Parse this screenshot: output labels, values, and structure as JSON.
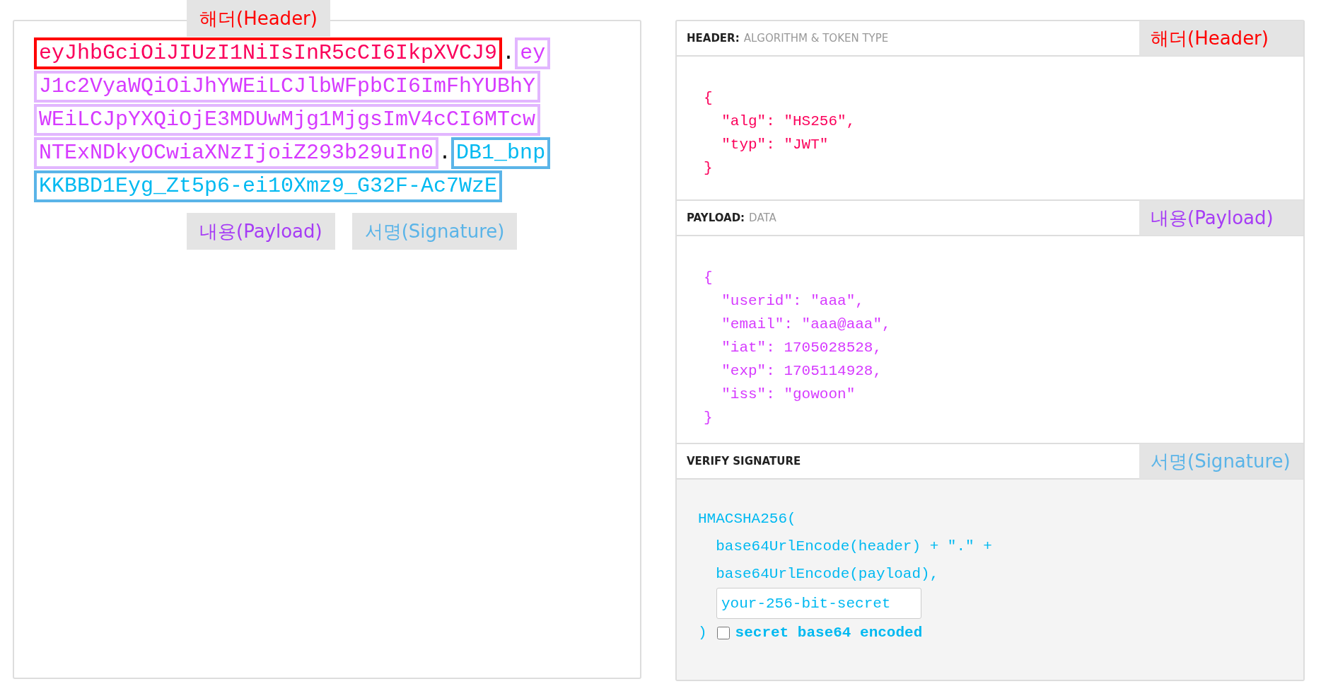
{
  "token": {
    "lines": [
      [
        {
          "kind": "header",
          "text": "eyJhbGciOiJIUzI1NiIsInR5cCI6IkpXVCJ9"
        },
        {
          "kind": "dot",
          "text": "."
        },
        {
          "kind": "payload",
          "text": "ey"
        }
      ],
      [
        {
          "kind": "payload",
          "text": "J1c2VyaWQiOiJhYWEiLCJlbWFpbCI6ImFhYUBhY"
        }
      ],
      [
        {
          "kind": "payload",
          "text": "WEiLCJpYXQiOjE3MDUwMjg1MjgsImV4cCI6MTcw"
        }
      ],
      [
        {
          "kind": "payload",
          "text": "NTExNDkyOCwiaXNzIjoiZ293b29uIn0"
        },
        {
          "kind": "dot",
          "text": "."
        },
        {
          "kind": "signature",
          "text": "DB1_bnp"
        }
      ],
      [
        {
          "kind": "signature",
          "text": "KKBBD1Eyg_Zt5p6-ei10Xmz9_G32F-Ac7WzE"
        }
      ]
    ],
    "labels": [
      {
        "text": "해더(Header)",
        "color": "#ff0000"
      },
      {
        "text": "내용(Payload)",
        "color": "#a63cf5"
      },
      {
        "text": "서명(Signature)",
        "color": "#5ab4e8"
      }
    ]
  },
  "sections": [
    {
      "kind": "header",
      "title": "HEADER:",
      "subtitle": "ALGORITHM & TOKEN TYPE",
      "label": "해더(Header)",
      "color": "#ff0000",
      "code": [
        "{",
        "  \"alg\": \"HS256\",",
        "  \"typ\": \"JWT\"",
        "}"
      ]
    },
    {
      "kind": "payload",
      "title": "PAYLOAD:",
      "subtitle": "DATA",
      "label": "내용(Payload)",
      "color": "#a63cf5",
      "code": [
        "{",
        "  \"userid\": \"aaa\",",
        "  \"email\": \"aaa@aaa\",",
        "  \"iat\": 1705028528,",
        "  \"exp\": 1705114928,",
        "  \"iss\": \"gowoon\"",
        "}"
      ]
    },
    {
      "kind": "signature",
      "title": "VERIFY SIGNATURE",
      "label": "서명(Signature)",
      "color": "#5ab4e8",
      "code": [
        "HMACSHA256(",
        "  base64UrlEncode(header) + \".\" +",
        "  base64UrlEncode(payload),"
      ],
      "secret": {
        "placeholder": "your-256-bit-secret"
      },
      "close": ")",
      "base64": {
        "label": "secret base64 encoded",
        "checked": false
      }
    }
  ]
}
